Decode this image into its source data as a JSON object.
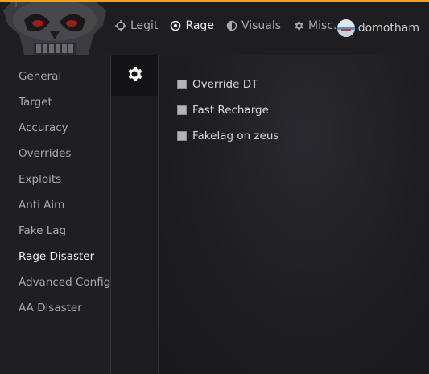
{
  "theme": {
    "accent": "#f5a020",
    "background": "#1b1b1e"
  },
  "header": {
    "logo_icon": "skull-logo",
    "nav": [
      {
        "label": "Legit",
        "icon": "crosshair-icon",
        "active": false
      },
      {
        "label": "Rage",
        "icon": "target-icon",
        "active": true
      },
      {
        "label": "Visuals",
        "icon": "half-circle-icon",
        "active": false
      },
      {
        "label": "Misc.",
        "icon": "gear-icon",
        "active": false
      }
    ],
    "user": {
      "name": "domotham",
      "avatar_icon": "avatar"
    }
  },
  "sidebar": {
    "items": [
      {
        "label": "General"
      },
      {
        "label": "Target"
      },
      {
        "label": "Accuracy"
      },
      {
        "label": "Overrides"
      },
      {
        "label": "Exploits"
      },
      {
        "label": "Anti Aim"
      },
      {
        "label": "Fake Lag"
      },
      {
        "label": "Rage Disaster",
        "active": true
      },
      {
        "label": "Advanced Config"
      },
      {
        "label": "AA Disaster"
      }
    ]
  },
  "subtabs": [
    {
      "icon": "gear-icon",
      "active": true
    }
  ],
  "options": [
    {
      "label": "Override DT",
      "checked": false
    },
    {
      "label": "Fast Recharge",
      "checked": false
    },
    {
      "label": "Fakelag on zeus",
      "checked": false
    }
  ]
}
